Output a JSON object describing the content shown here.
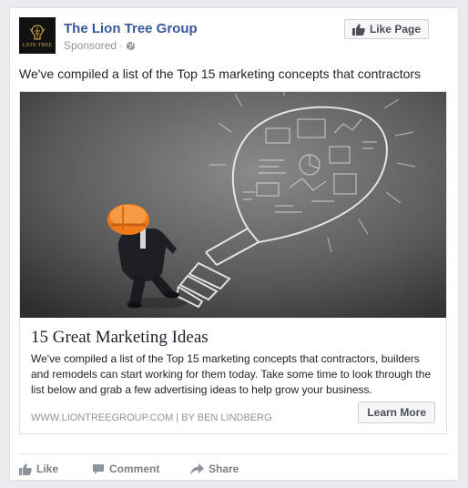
{
  "post": {
    "page_name": "The Lion Tree Group",
    "sponsored": "Sponsored",
    "logo_text": "LION TREE",
    "like_page_label": "Like Page",
    "text": "We've compiled a list of the Top 15 marketing concepts that contractors"
  },
  "ad": {
    "title": "15 Great Marketing Ideas",
    "description": "We've compiled a list of the Top 15 marketing concepts that contractors, builders and remodels can start working for them today. Take some time to look through the list below and grab a few advertising ideas to help grow your business.",
    "domain": "WWW.LIONTREEGROUP.COM | BY BEN LINDBERG",
    "cta_label": "Learn More"
  },
  "actions": {
    "like": "Like",
    "comment": "Comment",
    "share": "Share"
  },
  "colors": {
    "brand_link": "#365899",
    "helmet": "#f07a1a",
    "muted": "#90949c"
  },
  "icons": [
    "globe-icon",
    "thumbs-up-icon",
    "comment-icon",
    "share-icon"
  ]
}
